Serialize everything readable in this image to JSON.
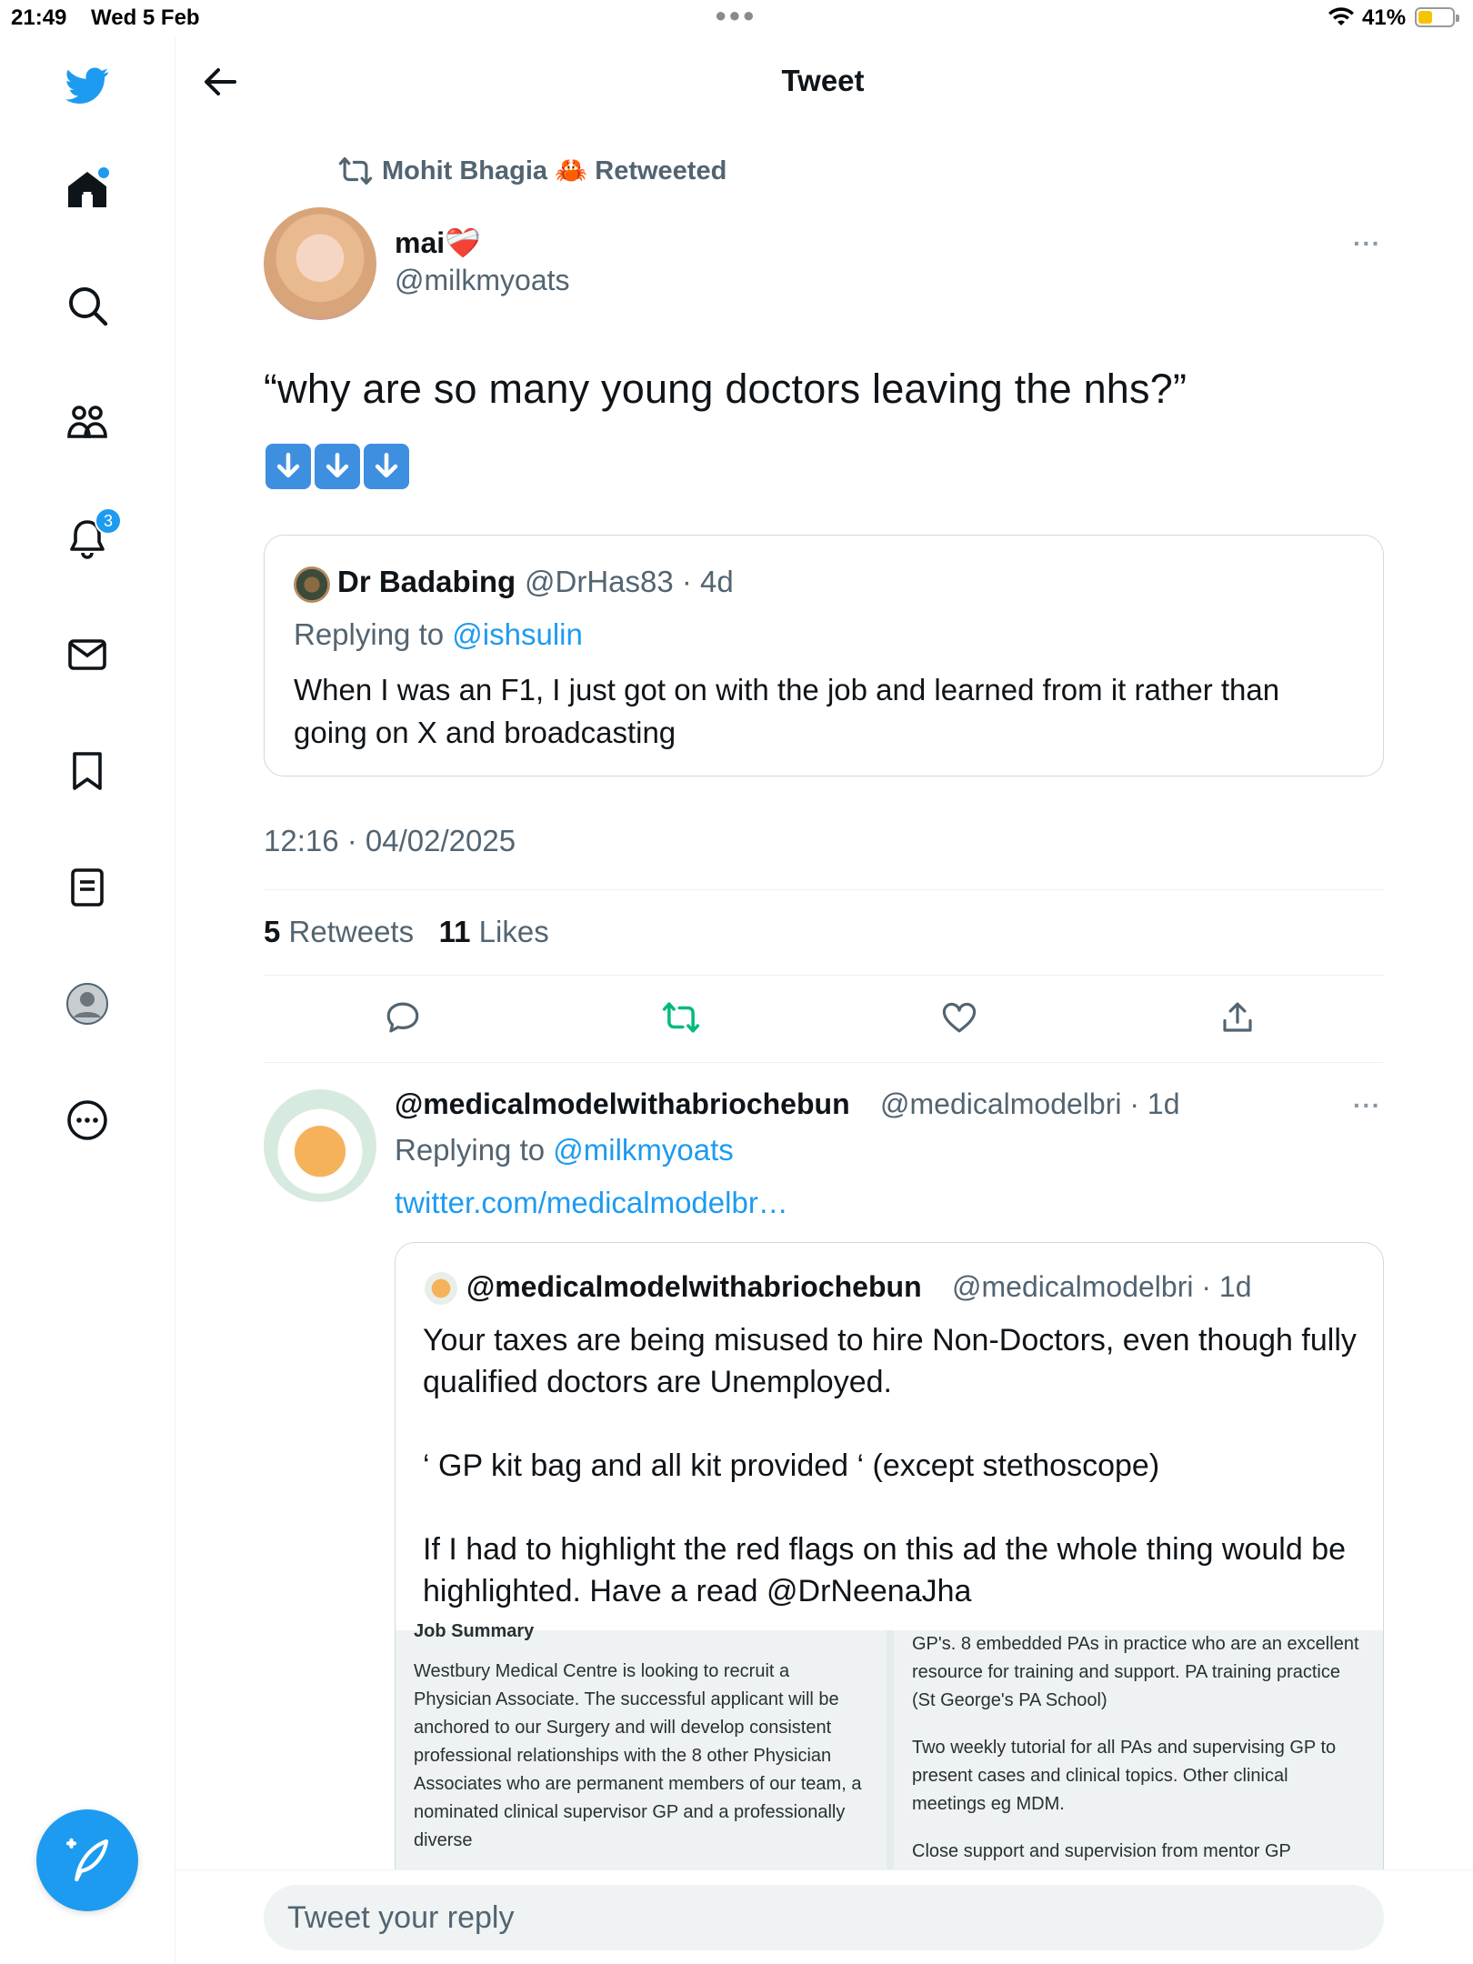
{
  "status_bar": {
    "time": "21:49",
    "date": "Wed 5 Feb",
    "battery_percent": "41%",
    "battery_level": 0.41
  },
  "header": {
    "title": "Tweet"
  },
  "sidebar": {
    "items": [
      {
        "name": "home",
        "icon": "home-icon",
        "has_dot": true
      },
      {
        "name": "explore",
        "icon": "search-icon"
      },
      {
        "name": "communities",
        "icon": "people-icon"
      },
      {
        "name": "notifications",
        "icon": "bell-icon",
        "badge": "3"
      },
      {
        "name": "messages",
        "icon": "mail-icon"
      },
      {
        "name": "bookmarks",
        "icon": "bookmark-icon"
      },
      {
        "name": "lists",
        "icon": "list-icon"
      },
      {
        "name": "profile",
        "icon": "avatar-icon"
      },
      {
        "name": "more",
        "icon": "more-circle-icon"
      }
    ],
    "compose_icon": "compose-icon"
  },
  "tweet": {
    "retweeted_by": "Mohit Bhagia 🦀 Retweeted",
    "author_name": "mai❤️‍🩹",
    "author_handle": "@milkmyoats",
    "text": "“why are so many young doctors leaving the nhs?”",
    "emoji": [
      "⬇",
      "⬇",
      "⬇"
    ],
    "quoted": {
      "name": "Dr Badabing",
      "handle_time": "@DrHas83 · 4d",
      "replying_label": "Replying to",
      "replying_to": "@ishsulin",
      "text": "When I was an F1, I just got on with the job and learned from it rather than going on X and broadcasting"
    },
    "timestamp": "12:16 · 04/02/2025",
    "retweets_count": "5",
    "retweets_label": "Retweets",
    "likes_count": "11",
    "likes_label": "Likes",
    "colors": {
      "accent": "#1d9bf0",
      "retweet_green": "#00ba7c",
      "muted": "#536471"
    }
  },
  "reply": {
    "name": "@medicalmodelwithabriochebun",
    "handle_time": "@medicalmodelbri · 1d",
    "replying_label": "Replying to",
    "replying_to": "@milkmyoats",
    "link": "twitter.com/medicalmodelbr…",
    "quoted": {
      "name": "@medicalmodelwithabriochebun",
      "handle_time": "@medicalmodelbri · 1d",
      "paragraphs": [
        "Your taxes are being misused to hire Non-Doctors, even though fully qualified doctors are Unemployed.",
        "‘ GP kit bag and all kit provided ‘ (except stethoscope)",
        "If I had to highlight the red flags on this ad the whole thing would be highlighted. Have a read @DrNeenaJha"
      ],
      "image": {
        "left_heading_cut": "Job Summary",
        "left_text": "Westbury Medical Centre is looking to recruit a Physician Associate. The successful applicant will be anchored to our Surgery and will develop consistent professional relationships with the 8 other Physician Associates who are permanent members of our team, a nominated clinical supervisor GP and a professionally diverse",
        "right_p1": "GP's. 8 embedded PAs in practice who are an excellent resource for training and support. PA training practice (St George's PA School)",
        "right_p2": "Two weekly tutorial for all PAs and supervising GP to present cases and clinical topics. Other clinical meetings eg MDM.",
        "right_p3": "Close support and supervision from mentor GP"
      }
    }
  },
  "reply_bar": {
    "placeholder": "Tweet your reply"
  }
}
